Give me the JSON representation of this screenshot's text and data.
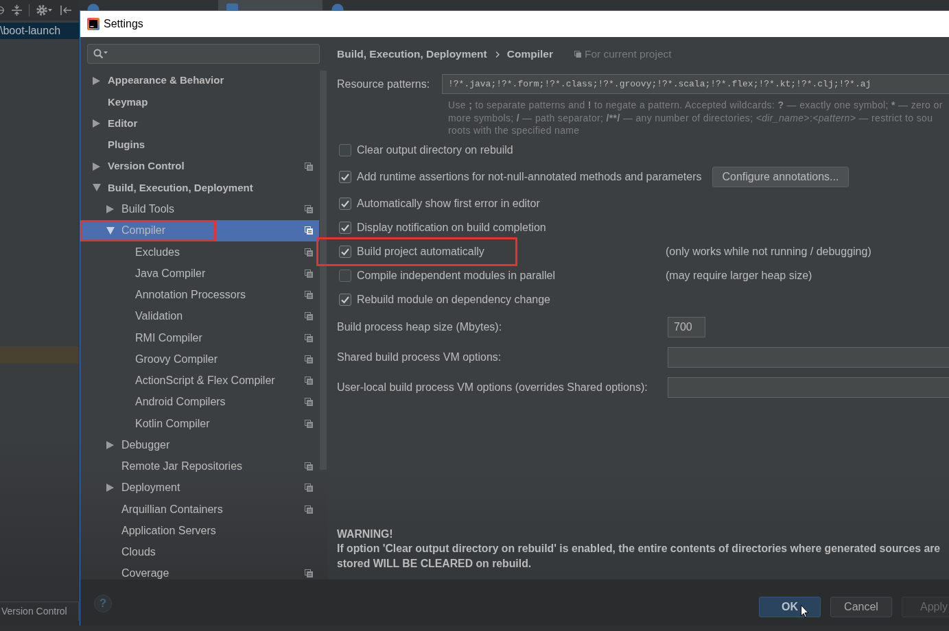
{
  "ide": {
    "editor_tabs": [
      {
        "kind": "class",
        "selected": false
      },
      {
        "kind": "module",
        "selected": true
      },
      {
        "kind": "class",
        "selected": false
      }
    ],
    "project_path": "\\boot-launch",
    "tool_window_button": "Version Control"
  },
  "dialog": {
    "title": "Settings",
    "tree": [
      {
        "label": "Appearance & Behavior",
        "expanded": false,
        "selected": false,
        "project_scope": false,
        "highlighted": false
      },
      {
        "label": "Keymap",
        "selected": false,
        "project_scope": false,
        "highlighted": false
      },
      {
        "label": "Editor",
        "expanded": false,
        "selected": false,
        "project_scope": false,
        "highlighted": false
      },
      {
        "label": "Plugins",
        "selected": false,
        "project_scope": false,
        "highlighted": false
      },
      {
        "label": "Version Control",
        "expanded": false,
        "selected": false,
        "project_scope": true,
        "highlighted": false
      },
      {
        "label": "Build, Execution, Deployment",
        "expanded": true,
        "selected": false,
        "project_scope": false,
        "highlighted": false,
        "children": [
          {
            "label": "Build Tools",
            "expanded": false,
            "selected": false,
            "project_scope": true,
            "highlighted": false
          },
          {
            "label": "Compiler",
            "expanded": true,
            "selected": true,
            "project_scope": true,
            "highlighted": true,
            "children": [
              {
                "label": "Excludes",
                "selected": false,
                "project_scope": true,
                "highlighted": false
              },
              {
                "label": "Java Compiler",
                "selected": false,
                "project_scope": true,
                "highlighted": false
              },
              {
                "label": "Annotation Processors",
                "selected": false,
                "project_scope": true,
                "highlighted": false
              },
              {
                "label": "Validation",
                "selected": false,
                "project_scope": true,
                "highlighted": false
              },
              {
                "label": "RMI Compiler",
                "selected": false,
                "project_scope": true,
                "highlighted": false
              },
              {
                "label": "Groovy Compiler",
                "selected": false,
                "project_scope": true,
                "highlighted": false
              },
              {
                "label": "ActionScript & Flex Compiler",
                "selected": false,
                "project_scope": true,
                "highlighted": false
              },
              {
                "label": "Android Compilers",
                "selected": false,
                "project_scope": true,
                "highlighted": false
              },
              {
                "label": "Kotlin Compiler",
                "selected": false,
                "project_scope": true,
                "highlighted": false
              }
            ]
          },
          {
            "label": "Debugger",
            "expanded": false,
            "selected": false,
            "project_scope": false,
            "highlighted": false
          },
          {
            "label": "Remote Jar Repositories",
            "selected": false,
            "project_scope": true,
            "highlighted": false
          },
          {
            "label": "Deployment",
            "expanded": false,
            "selected": false,
            "project_scope": true,
            "highlighted": false
          },
          {
            "label": "Arquillian Containers",
            "selected": false,
            "project_scope": true,
            "highlighted": false
          },
          {
            "label": "Application Servers",
            "selected": false,
            "project_scope": false,
            "highlighted": false
          },
          {
            "label": "Clouds",
            "selected": false,
            "project_scope": false,
            "highlighted": false
          },
          {
            "label": "Coverage",
            "selected": false,
            "project_scope": true,
            "highlighted": false
          }
        ]
      }
    ],
    "breadcrumb": [
      "Build, Execution, Deployment",
      "Compiler"
    ],
    "scope_note": "For current project",
    "resource_patterns": {
      "label": "Resource patterns:",
      "value": "!?*.java;!?*.form;!?*.class;!?*.groovy;!?*.scala;!?*.flex;!?*.kt;!?*.clj;!?*.aj",
      "hint_lines": [
        [
          {
            "text": "Use ",
            "kind": "plain"
          },
          {
            "text": ";",
            "kind": "bold"
          },
          {
            "text": " to separate patterns and ",
            "kind": "plain"
          },
          {
            "text": "!",
            "kind": "bold"
          },
          {
            "text": " to negate a pattern. Accepted wildcards: ",
            "kind": "plain"
          },
          {
            "text": "?",
            "kind": "bold"
          },
          {
            "text": " — exactly one symbol; ",
            "kind": "plain"
          },
          {
            "text": "*",
            "kind": "bold"
          },
          {
            "text": " — zero or",
            "kind": "plain"
          }
        ],
        [
          {
            "text": "more symbols; ",
            "kind": "plain"
          },
          {
            "text": "/",
            "kind": "bold"
          },
          {
            "text": " — path separator; ",
            "kind": "plain"
          },
          {
            "text": "/**/",
            "kind": "bold"
          },
          {
            "text": " — any number of directories; ",
            "kind": "plain"
          },
          {
            "text": "<dir_name>",
            "kind": "italic"
          },
          {
            "text": ":",
            "kind": "plain"
          },
          {
            "text": "<pattern>",
            "kind": "italic"
          },
          {
            "text": " — restrict to sou",
            "kind": "plain"
          }
        ],
        [
          {
            "text": "roots with the specified name",
            "kind": "plain"
          }
        ]
      ]
    },
    "options": [
      {
        "label": "Clear output directory on rebuild",
        "checked": false,
        "highlighted": false
      },
      {
        "label": "Add runtime assertions for not-null-annotated methods and parameters",
        "checked": true,
        "highlighted": false,
        "button": "Configure annotations..."
      },
      {
        "label": "Automatically show first error in editor",
        "checked": true,
        "highlighted": false
      },
      {
        "label": "Display notification on build completion",
        "checked": true,
        "highlighted": false
      },
      {
        "label": "Build project automatically",
        "checked": true,
        "highlighted": true,
        "note": "(only works while not running / debugging)"
      },
      {
        "label": "Compile independent modules in parallel",
        "checked": false,
        "highlighted": false,
        "note": "(may require larger heap size)"
      },
      {
        "label": "Rebuild module on dependency change",
        "checked": true,
        "highlighted": false
      }
    ],
    "fields": [
      {
        "label": "Build process heap size (Mbytes):",
        "value": "700",
        "kind": "short"
      },
      {
        "label": "Shared build process VM options:",
        "kind": "wide"
      },
      {
        "label": "User-local build process VM options (overrides Shared options):",
        "kind": "wide"
      }
    ],
    "warning": {
      "title": "WARNING!",
      "text": "If option 'Clear output directory on rebuild' is enabled, the entire contents of directories where generated sources are stored WILL BE CLEARED on rebuild."
    },
    "help_button": "?",
    "buttons": [
      {
        "label": "OK",
        "default": true,
        "disabled": false
      },
      {
        "label": "Cancel",
        "default": false,
        "disabled": false
      },
      {
        "label": "Apply",
        "default": false,
        "disabled": true
      }
    ]
  }
}
